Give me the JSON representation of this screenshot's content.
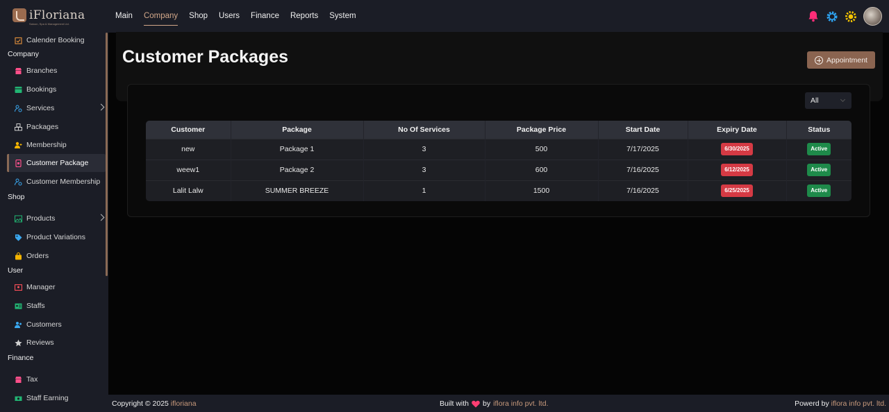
{
  "app": {
    "logo_text": "iFloriana",
    "logo_sub": "Saloon, Spa & Management Ltd."
  },
  "topnav": [
    {
      "label": "Main"
    },
    {
      "label": "Company",
      "active": true
    },
    {
      "label": "Shop"
    },
    {
      "label": "Users"
    },
    {
      "label": "Finance"
    },
    {
      "label": "Reports"
    },
    {
      "label": "System"
    }
  ],
  "top_icons": [
    "bell-icon",
    "gear-icon",
    "sun-icon",
    "avatar"
  ],
  "sidebar": {
    "items": [
      {
        "label": "Calender Booking",
        "icon": "calendar-check-icon"
      },
      {
        "section": "Company"
      },
      {
        "label": "Branches",
        "icon": "shop-icon"
      },
      {
        "label": "Bookings",
        "icon": "table-icon"
      },
      {
        "label": "Services",
        "icon": "people-gear-icon",
        "submenu": true
      },
      {
        "label": "Packages",
        "icon": "boxes-icon"
      },
      {
        "label": "Membership",
        "icon": "user-plus-icon"
      },
      {
        "label": "Customer Package",
        "icon": "card-icon",
        "active": true
      },
      {
        "label": "Customer Membership",
        "icon": "people-gear-icon"
      },
      {
        "section": "Shop"
      },
      {
        "label": "Products",
        "icon": "image-icon",
        "submenu": true
      },
      {
        "label": "Product Variations",
        "icon": "tag-icon"
      },
      {
        "label": "Orders",
        "icon": "bag-icon"
      },
      {
        "section": "User"
      },
      {
        "label": "Manager",
        "icon": "id-card-icon"
      },
      {
        "label": "Staffs",
        "icon": "id-badge-icon"
      },
      {
        "label": "Customers",
        "icon": "users-icon"
      },
      {
        "label": "Reviews",
        "icon": "star-icon"
      },
      {
        "section": "Finance"
      },
      {
        "label": "Tax",
        "icon": "shop-icon"
      },
      {
        "label": "Staff Earning",
        "icon": "money-icon"
      }
    ]
  },
  "main": {
    "title": "Customer Packages",
    "appointment_button": "Appointment",
    "filter": {
      "selected": "All"
    },
    "table": {
      "headers": [
        "Customer",
        "Package",
        "No Of Services",
        "Package Price",
        "Start Date",
        "Expiry Date",
        "Status"
      ],
      "rows": [
        {
          "customer": "new",
          "package": "Package 1",
          "services": "3",
          "price": "500",
          "start": "7/17/2025",
          "expiry": "6/30/2025",
          "status": "Active"
        },
        {
          "customer": "weew1",
          "package": "Package 2",
          "services": "3",
          "price": "600",
          "start": "7/16/2025",
          "expiry": "6/12/2025",
          "status": "Active"
        },
        {
          "customer": "Lalit Lalw",
          "package": "SUMMER BREEZE",
          "services": "1",
          "price": "1500",
          "start": "7/16/2025",
          "expiry": "6/25/2025",
          "status": "Active"
        }
      ]
    }
  },
  "footer": {
    "copyright": "Copyright © 2025",
    "brand": "ifloriana",
    "built_with": "Built with",
    "by": "by",
    "builder": "iflora info pvt. ltd.",
    "powered": "Powerd by",
    "powered_by": "iflora info pvt. ltd."
  },
  "colors": {
    "accent": "#8a6450",
    "danger": "#d53a44",
    "success": "#1e8a4a",
    "bell": "#ff2d78",
    "gear": "#2ea3f2",
    "sun": "#f5c400"
  }
}
